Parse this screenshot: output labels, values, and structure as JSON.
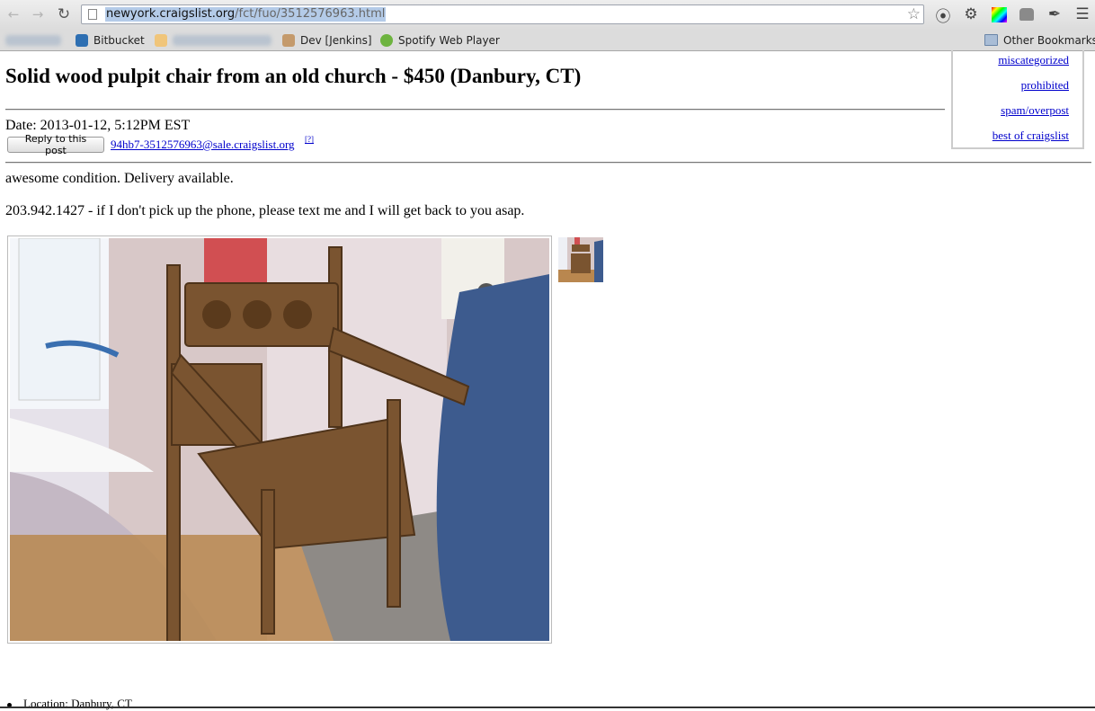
{
  "browser": {
    "url_host": "newyork.craigslist.org",
    "url_path": "/fct/fuo/3512576963.html",
    "icons": [
      "back-arrow-icon",
      "forward-arrow-icon",
      "reload-icon",
      "star-icon",
      "extension-icon",
      "wrench-icon",
      "color-picker-icon",
      "ghostery-icon",
      "eyedropper-icon",
      "menu-icon"
    ],
    "bookmarks": [
      {
        "label": "Bitbucket",
        "color": "#2e6fb2"
      },
      {
        "label": "Dev [Jenkins]",
        "color": "#c49a6c"
      },
      {
        "label": "Spotify Web Player",
        "color": "#6db33f"
      }
    ],
    "other_bookmarks": "Other Bookmarks"
  },
  "flags": {
    "items": [
      "miscategorized",
      "prohibited",
      "spam/overpost",
      "best of craigslist"
    ]
  },
  "posting": {
    "title": "Solid wood pulpit chair from an old church - $450 (Danbury, CT)",
    "date": "Date: 2013-01-12, 5:12PM EST",
    "reply_label": "Reply to this post",
    "email": "94hb7-3512576963@sale.craigslist.org",
    "help": "[?]",
    "body_line_1": "awesome condition. Delivery available.",
    "body_line_2": "203.942.1427 - if I don't pick up the phone, please text me and I will get back to you asap.",
    "location": "Location: Danbury, CT"
  }
}
